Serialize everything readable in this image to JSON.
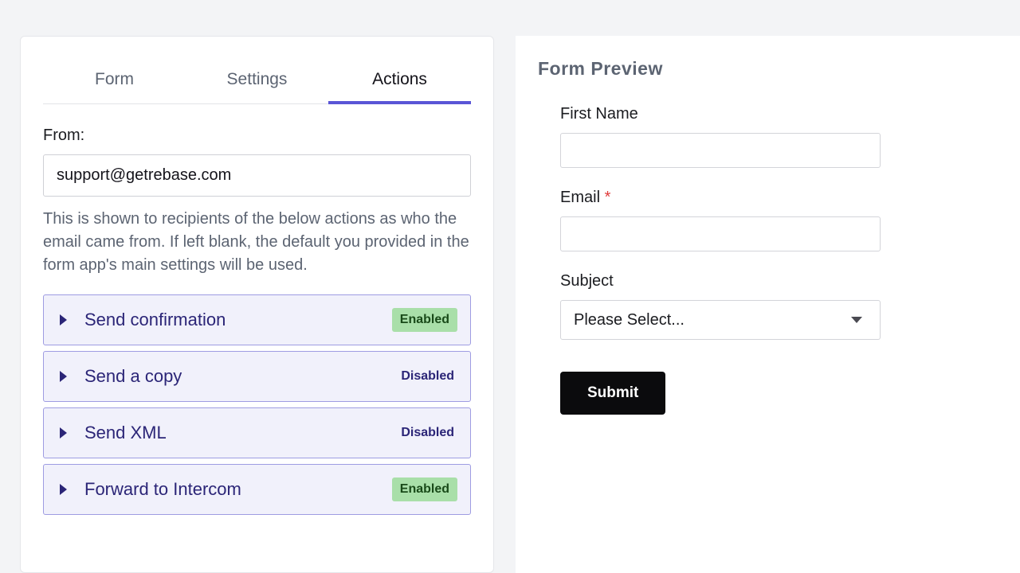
{
  "tabs": {
    "form": "Form",
    "settings": "Settings",
    "actions": "Actions"
  },
  "from": {
    "label": "From:",
    "value": "support@getrebase.com",
    "help": "This is shown to recipients of the below actions as who the email came from. If left blank, the default you provided in the form app's main settings will be used."
  },
  "actions": [
    {
      "title": "Send confirmation",
      "status": "Enabled"
    },
    {
      "title": "Send a copy",
      "status": "Disabled"
    },
    {
      "title": "Send XML",
      "status": "Disabled"
    },
    {
      "title": "Forward to Intercom",
      "status": "Enabled"
    }
  ],
  "preview": {
    "heading": "Form Preview",
    "first_name_label": "First Name",
    "email_label": "Email",
    "required_mark": "*",
    "subject_label": "Subject",
    "subject_placeholder": "Please Select...",
    "submit_label": "Submit"
  }
}
